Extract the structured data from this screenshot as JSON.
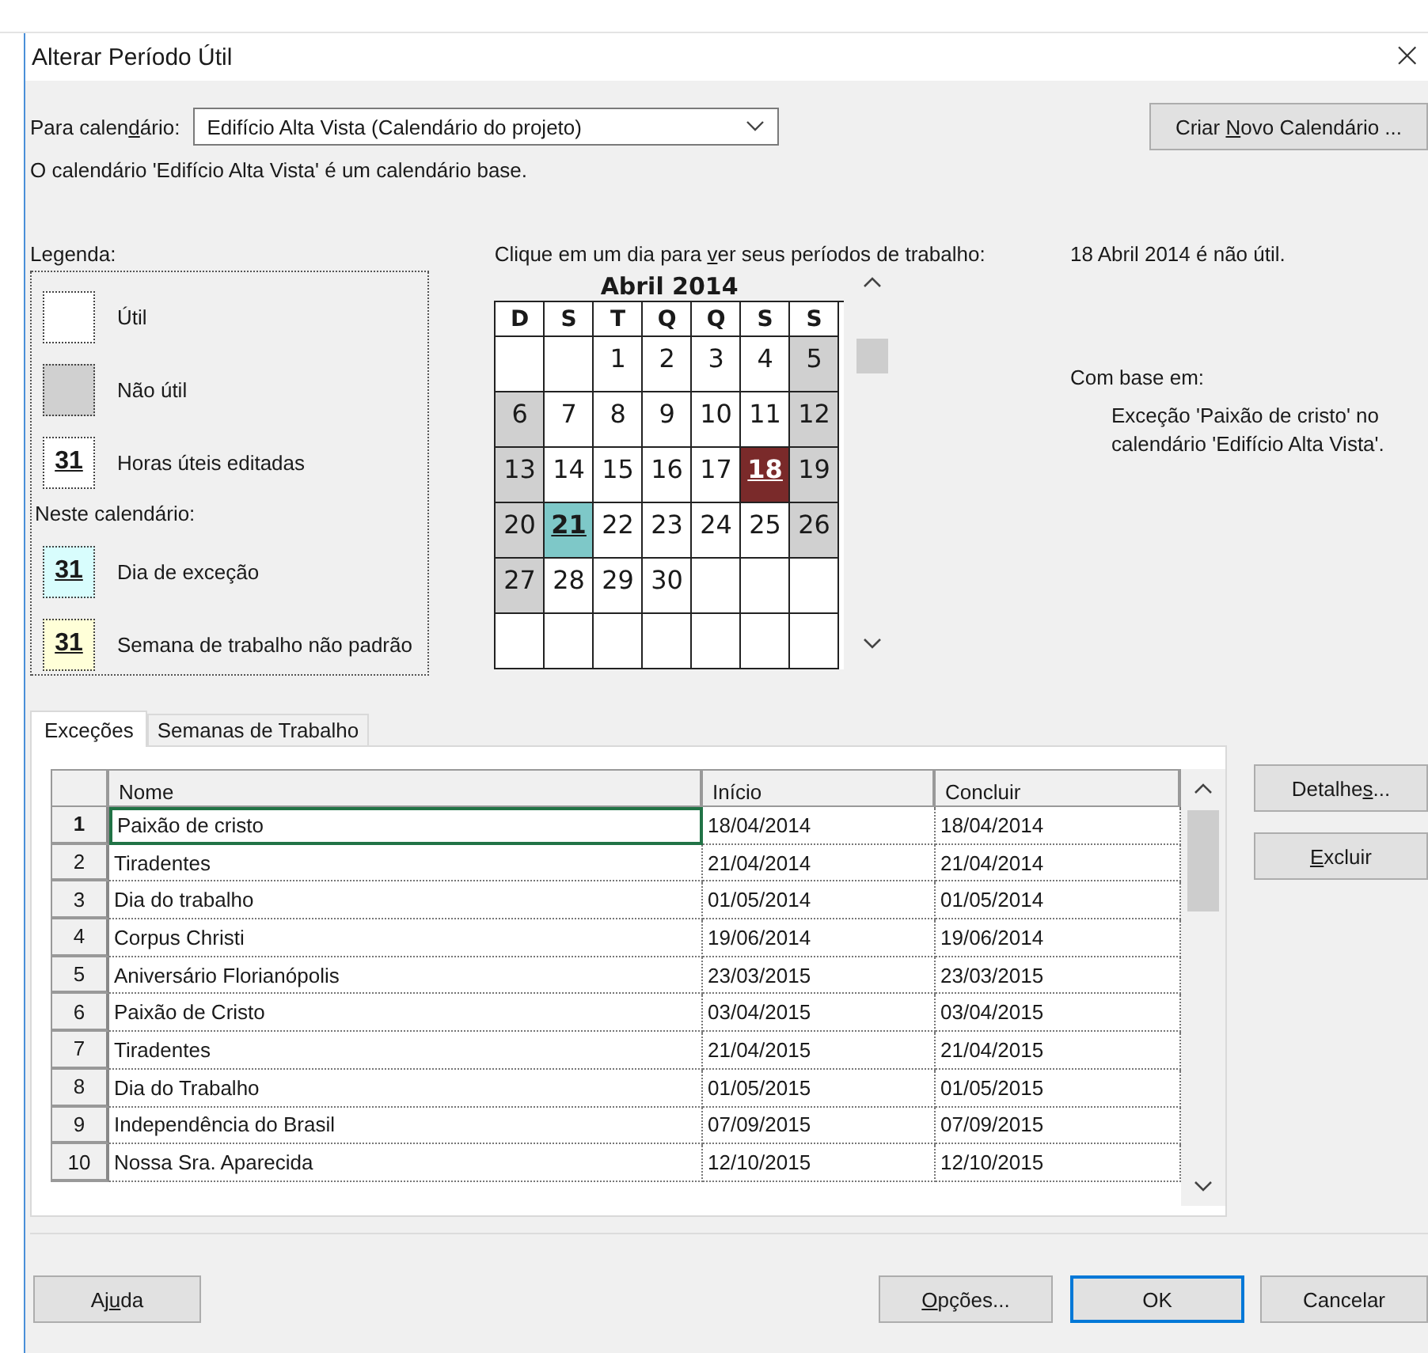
{
  "window": {
    "title": "Alterar Período Útil",
    "close": "×"
  },
  "calendar_picker": {
    "label": [
      "Para calen",
      "d",
      "ário:"
    ],
    "value": "Edifício Alta Vista (Calendário do projeto)"
  },
  "new_calendar_button": [
    "Criar ",
    "N",
    "ovo Calendário ..."
  ],
  "base_note": "O calendário 'Edifício Alta Vista' é um calendário base.",
  "legend": {
    "title": "Legenda:",
    "items": [
      {
        "kind": "blank",
        "label": "Útil"
      },
      {
        "kind": "nonwork",
        "label": "Não útil"
      },
      {
        "kind": "edited",
        "swatch": "31",
        "label": "Horas úteis editadas"
      },
      {
        "kind": "heading",
        "label": "Neste calendário:"
      },
      {
        "kind": "exception",
        "swatch": "31",
        "label": "Dia de exceção"
      },
      {
        "kind": "nonstandard",
        "swatch": "31",
        "label": "Semana de trabalho não padrão"
      }
    ]
  },
  "calendar": {
    "prompt": [
      "Clique em um dia para ",
      "v",
      "er seus períodos de trabalho:"
    ],
    "month": "Abril 2014",
    "weekdays": [
      "D",
      "S",
      "T",
      "Q",
      "Q",
      "S",
      "S"
    ],
    "weeks": [
      [
        {
          "kind": "empty"
        },
        {
          "kind": "empty"
        },
        {
          "kind": "work",
          "day": "1"
        },
        {
          "kind": "work",
          "day": "2"
        },
        {
          "kind": "work",
          "day": "3"
        },
        {
          "kind": "work",
          "day": "4"
        },
        {
          "kind": "nonwork",
          "day": "5"
        }
      ],
      [
        {
          "kind": "nonwork",
          "day": "6"
        },
        {
          "kind": "work",
          "day": "7"
        },
        {
          "kind": "work",
          "day": "8"
        },
        {
          "kind": "work",
          "day": "9"
        },
        {
          "kind": "work",
          "day": "10"
        },
        {
          "kind": "work",
          "day": "11"
        },
        {
          "kind": "nonwork",
          "day": "12"
        }
      ],
      [
        {
          "kind": "nonwork",
          "day": "13"
        },
        {
          "kind": "work",
          "day": "14"
        },
        {
          "kind": "work",
          "day": "15"
        },
        {
          "kind": "work",
          "day": "16"
        },
        {
          "kind": "work",
          "day": "17"
        },
        {
          "kind": "exception",
          "day": "18",
          "selected": true
        },
        {
          "kind": "nonwork",
          "day": "19"
        }
      ],
      [
        {
          "kind": "nonwork",
          "day": "20"
        },
        {
          "kind": "exception",
          "day": "21",
          "selected": false
        },
        {
          "kind": "work",
          "day": "22"
        },
        {
          "kind": "work",
          "day": "23"
        },
        {
          "kind": "work",
          "day": "24"
        },
        {
          "kind": "work",
          "day": "25"
        },
        {
          "kind": "nonwork",
          "day": "26"
        }
      ],
      [
        {
          "kind": "nonwork",
          "day": "27"
        },
        {
          "kind": "work",
          "day": "28"
        },
        {
          "kind": "work",
          "day": "29"
        },
        {
          "kind": "work",
          "day": "30"
        },
        {
          "kind": "empty"
        },
        {
          "kind": "empty"
        },
        {
          "kind": "empty"
        }
      ],
      [
        {
          "kind": "empty"
        },
        {
          "kind": "empty"
        },
        {
          "kind": "empty"
        },
        {
          "kind": "empty"
        },
        {
          "kind": "empty"
        },
        {
          "kind": "empty"
        },
        {
          "kind": "empty"
        }
      ]
    ]
  },
  "day_status": "18 Abril 2014 é não útil.",
  "based_on": {
    "title": "Com base em:",
    "text": "Exceção 'Paixão de cristo' no calendário 'Edifício Alta Vista'."
  },
  "tabs": [
    {
      "label": "Exceções",
      "selected": true
    },
    {
      "label": "Semanas de Trabalho",
      "selected": false
    }
  ],
  "table": {
    "columns": [
      "Nome",
      "Início",
      "Concluir"
    ],
    "rows": [
      {
        "number": "1",
        "name": "Paixão de cristo",
        "start": "18/04/2014",
        "end": "18/04/2014",
        "selected": true
      },
      {
        "number": "2",
        "name": "Tiradentes",
        "start": "21/04/2014",
        "end": "21/04/2014",
        "selected": false
      },
      {
        "number": "3",
        "name": "Dia do trabalho",
        "start": "01/05/2014",
        "end": "01/05/2014",
        "selected": false
      },
      {
        "number": "4",
        "name": "Corpus Christi",
        "start": "19/06/2014",
        "end": "19/06/2014",
        "selected": false
      },
      {
        "number": "5",
        "name": "Aniversário Florianópolis",
        "start": "23/03/2015",
        "end": "23/03/2015",
        "selected": false
      },
      {
        "number": "6",
        "name": "Paixão de Cristo",
        "start": "03/04/2015",
        "end": "03/04/2015",
        "selected": false
      },
      {
        "number": "7",
        "name": "Tiradentes",
        "start": "21/04/2015",
        "end": "21/04/2015",
        "selected": false
      },
      {
        "number": "8",
        "name": "Dia do Trabalho",
        "start": "01/05/2015",
        "end": "01/05/2015",
        "selected": false
      },
      {
        "number": "9",
        "name": "Independência do Brasil",
        "start": "07/09/2015",
        "end": "07/09/2015",
        "selected": false
      },
      {
        "number": "10",
        "name": "Nossa Sra. Aparecida",
        "start": "12/10/2015",
        "end": "12/10/2015",
        "selected": false
      }
    ]
  },
  "side_buttons": [
    [
      "Detalhe",
      "s",
      "..."
    ],
    {
      "key": "E",
      "post": "xcluir"
    }
  ],
  "footer_buttons": [
    {
      "label": [
        "Aj",
        "u",
        "da"
      ],
      "default": false
    },
    {
      "label": {
        "key": "O",
        "post": "pções..."
      },
      "default": false
    },
    {
      "label": "OK",
      "default": true
    },
    {
      "label": "Cancelar",
      "default": false
    }
  ]
}
